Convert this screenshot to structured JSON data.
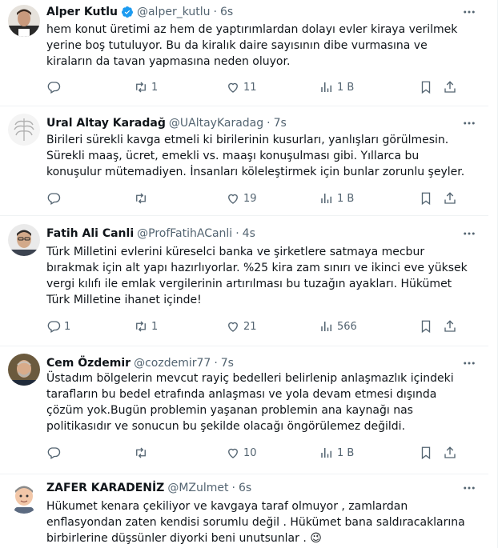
{
  "tweets": [
    {
      "name": "Alper Kutlu",
      "verified": true,
      "handle": "@alper_kutlu",
      "sep": "·",
      "time": "6s",
      "lines": [
        "hem konut üretimi az hem de yaptırımlardan dolayı evler kiraya verilmek",
        "yerine boş tutuluyor. Bu da kiralık daire sayısının dibe vurmasına ve",
        "kiraların da tavan yapmasına neden oluyor."
      ],
      "replies": "",
      "retweets": "1",
      "likes": "11",
      "views": "1 B"
    },
    {
      "name": "Ural Altay Karadağ",
      "verified": false,
      "handle": "@UAltayKaradag",
      "sep": "·",
      "time": "7s",
      "lines": [
        "Birileri sürekli kavga etmeli ki birilerinin kusurları, yanlışları görülmesin.",
        "Sürekli maaş, ücret, emekli vs. maaşı konuşulması gibi. Yıllarca bu",
        "konuşulur mütemadiyen. İnsanları köleleştirmek için bunlar zorunlu şeyler."
      ],
      "replies": "",
      "retweets": "",
      "likes": "19",
      "views": "1 B"
    },
    {
      "name": "Fatih Ali Canli",
      "verified": false,
      "handle": "@ProfFatihACanli",
      "sep": "·",
      "time": "4s",
      "lines": [
        "Türk Milletini evlerini küreselci banka ve şirketlere satmaya mecbur",
        "bırakmak için alt yapı hazırlıyorlar. %25 kira zam sınırı ve ikinci eve yüksek",
        "vergi kılıfı ile emlak vergilerinin artırılması bu tuzağın ayakları. Hükümet",
        "Türk Milletine ihanet içinde!"
      ],
      "replies": "1",
      "retweets": "1",
      "likes": "21",
      "views": "566"
    },
    {
      "name": "Cem Özdemir",
      "verified": false,
      "handle": "@cozdemir77",
      "sep": "·",
      "time": "7s",
      "lines": [
        "Üstadım bölgelerin mevcut rayiç bedelleri belirlenip anlaşmazlık içindeki",
        "tarafların bu bedel etrafında anlaşması ve yola devam etmesi dışında",
        "çözüm yok.Bugün problemin yaşanan problemin ana kaynağı nas",
        "politikasıdır ve sonucun bu şekilde olacağı öngörülemez değildi."
      ],
      "replies": "",
      "retweets": "",
      "likes": "10",
      "views": "1 B"
    },
    {
      "name": "ZAFER KARADENİZ",
      "verified": false,
      "handle": "@MZulmet",
      "sep": "·",
      "time": "6s",
      "lines": [
        "Hükumet kenara çekiliyor ve kavgaya taraf olmuyor , zamlardan",
        "enflasyondan zaten kendisi sorumlu değil . Hükümet bana saldıracaklarına",
        "birbirlerine düşsünler diyorki beni unutsunlar . 😉"
      ],
      "replies": "",
      "retweets": "",
      "likes": "",
      "views": ""
    }
  ],
  "icons": {
    "reply": "reply-icon",
    "retweet": "retweet-icon",
    "like": "like-icon",
    "views": "views-icon",
    "bookmark": "bookmark-icon",
    "share": "share-icon",
    "more": "more-icon",
    "verified": "verified-badge-icon"
  },
  "colors": {
    "text": "#0f1419",
    "secondary": "#536471",
    "verified": "#1d9bf0",
    "divider": "#eff3f4"
  }
}
